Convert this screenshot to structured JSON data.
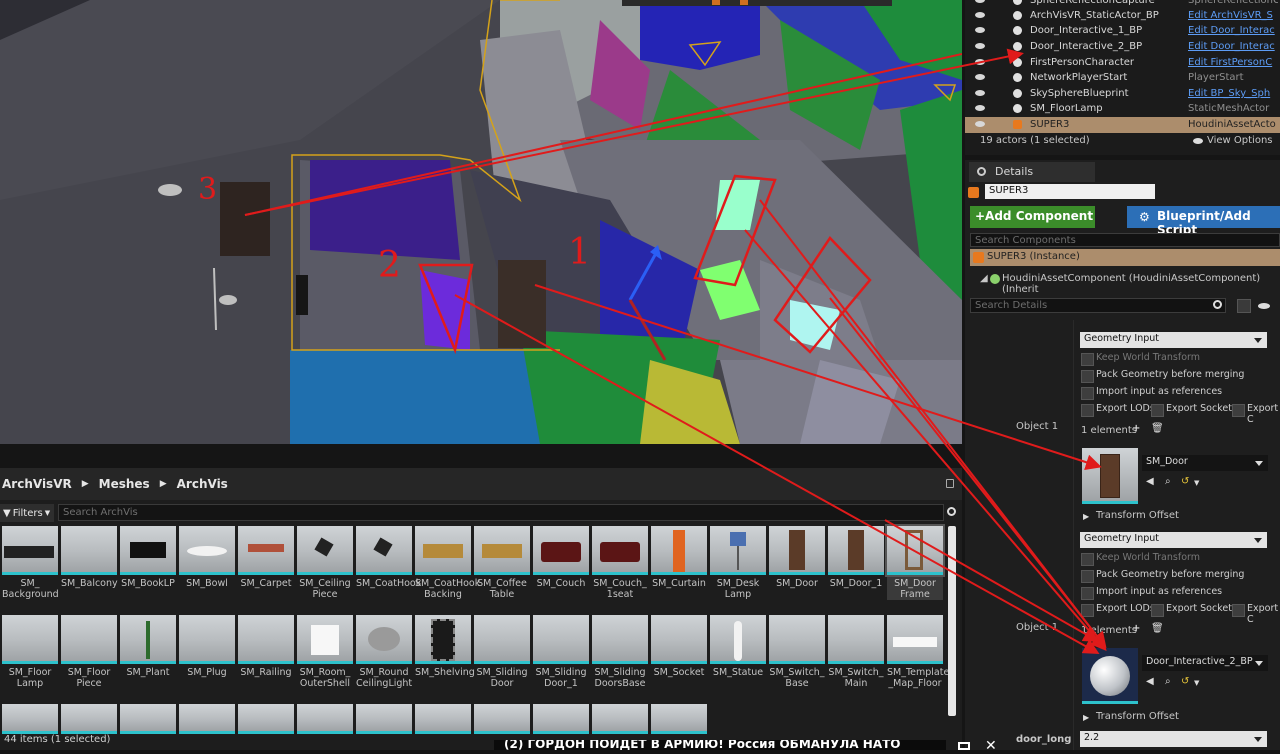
{
  "outliner": {
    "rows": [
      {
        "name": "SphereReflectionCapture",
        "type": "SphereReflectionC",
        "link": false
      },
      {
        "name": "ArchVisVR_StaticActor_BP",
        "type": "Edit ArchVisVR_S",
        "link": true
      },
      {
        "name": "Door_Interactive_1_BP",
        "type": "Edit Door_Interac",
        "link": true
      },
      {
        "name": "Door_Interactive_2_BP",
        "type": "Edit Door_Interac",
        "link": true
      },
      {
        "name": "FirstPersonCharacter",
        "type": "Edit FirstPersonC",
        "link": true
      },
      {
        "name": "NetworkPlayerStart",
        "type": "PlayerStart",
        "link": false
      },
      {
        "name": "SkySphereBlueprint",
        "type": "Edit BP_Sky_Sph",
        "link": true
      },
      {
        "name": "SM_FloorLamp",
        "type": "StaticMeshActor",
        "link": false
      },
      {
        "name": "SUPER3",
        "type": "HoudiniAssetActo",
        "link": false,
        "selected": true
      }
    ],
    "actor_count": "19 actors (1 selected)",
    "view_options": "View Options"
  },
  "details": {
    "tab": "Details",
    "actor_name": "SUPER3",
    "add_component": "+Add Component",
    "blueprint_script": "Blueprint/Add Script",
    "search_components_placeholder": "Search Components",
    "instance_row": "SUPER3 (Instance)",
    "component_row": "HoudiniAssetComponent (HoudiniAssetComponent) (Inherit",
    "search_details_placeholder": "Search Details",
    "input_type_1": "Geometry Input",
    "input_type_2": "Geometry Input",
    "keep_world_transform": "Keep World Transform",
    "pack_geometry": "Pack Geometry before merging",
    "import_refs": "Import input as references",
    "export_lods": "Export LODs",
    "export_sockets": "Export Sockets",
    "export_col": "Export C",
    "object_label": "Object 1",
    "elements_label": "1 elements",
    "asset_1": "SM_Door",
    "asset_2": "Door_Interactive_2_BP",
    "transform_offset": "Transform Offset",
    "door_long_label": "door_long",
    "door_long_value": "2.2"
  },
  "content_browser": {
    "breadcrumb": [
      "ArchVisVR",
      "Meshes",
      "ArchVis"
    ],
    "filters": "Filters",
    "search_placeholder": "Search ArchVis",
    "status": "44 items (1 selected)",
    "items": [
      "SM_\nBackground",
      "SM_Balcony",
      "SM_BookLP",
      "SM_Bowl",
      "SM_Carpet",
      "SM_Ceiling\nPiece",
      "SM_CoatHook",
      "SM_CoatHook\nBacking",
      "SM_Coffee\nTable",
      "SM_Couch",
      "SM_Couch_\n1seat",
      "SM_Curtain",
      "SM_Desk\nLamp",
      "SM_Door",
      "SM_Door_1",
      "SM_Door\nFrame",
      "SM_Floor\nLamp",
      "SM_Floor\nPiece",
      "SM_Plant",
      "SM_Plug",
      "SM_Railing",
      "SM_Room_\nOuterShell",
      "SM_Round\nCeilingLight",
      "SM_Shelving",
      "SM_Sliding\nDoor",
      "SM_Sliding\nDoor_1",
      "SM_Sliding\nDoorsBase",
      "SM_Socket",
      "SM_Statue",
      "SM_Switch_\nBase",
      "SM_Switch_\nMain",
      "SM_Template\n_Map_Floor"
    ]
  },
  "annotations": [
    "1",
    "2",
    "3"
  ],
  "video_banner": "(2) ГОРДОН ПОЙДЁТ В АРМИЮ! Россия ОБМАНУЛА НАТО",
  "colors": {
    "selection": "#ac8d6c",
    "accent_cyan": "#2ec2cc",
    "annotation_red": "#e01b1b",
    "add_green": "#3b8d2a",
    "blueprint_blue": "#2c6fb7"
  }
}
